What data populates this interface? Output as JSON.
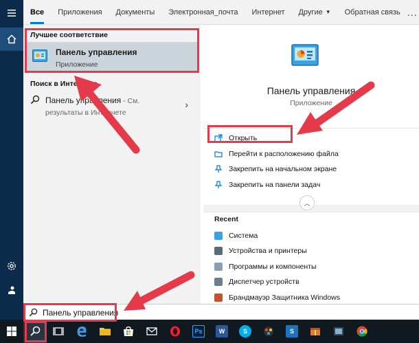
{
  "tabs": {
    "all": "Все",
    "apps": "Приложения",
    "documents": "Документы",
    "email": "Электронная_почта",
    "web": "Интернет",
    "other": "Другие",
    "feedback": "Обратная связь",
    "more": "..."
  },
  "results": {
    "best_match_label": "Лучшее соответствие",
    "best_match": {
      "name": "Панель управления",
      "type": "Приложение"
    },
    "web_label": "Поиск в Интернете",
    "web_item": {
      "query": "Панель управления",
      "suffix": " - См. результаты в Интернете"
    }
  },
  "preview": {
    "title": "Панель управления",
    "subtitle": "Приложение",
    "actions": [
      "Открыть",
      "Перейти к расположению файла",
      "Закрепить на начальном экране",
      "Закрепить на панели задач"
    ],
    "recent_label": "Recent",
    "recent": [
      "Система",
      "Устройства и принтеры",
      "Программы и компоненты",
      "Диспетчер устройств",
      "Брандмауэр Защитника Windows"
    ]
  },
  "search": {
    "value": "Панель управления"
  },
  "taskbar": {
    "photoshop_label": "Ps",
    "word_label": "W",
    "skype_label": "S",
    "snagit_label": "S"
  },
  "colors": {
    "accent": "#0078d7",
    "rail": "#0c2a4a",
    "highlight": "#e53a4a",
    "taskbar": "#101820"
  },
  "icons": {
    "rail": [
      "hamburger-icon",
      "home-icon",
      "gear-icon",
      "user-icon"
    ],
    "taskbar": [
      "windows-start-icon",
      "search-icon",
      "task-view-icon",
      "edge-icon",
      "file-explorer-icon",
      "store-icon",
      "mail-icon",
      "opera-icon",
      "photoshop-icon",
      "word-icon",
      "skype-icon",
      "chrome-icon"
    ]
  }
}
